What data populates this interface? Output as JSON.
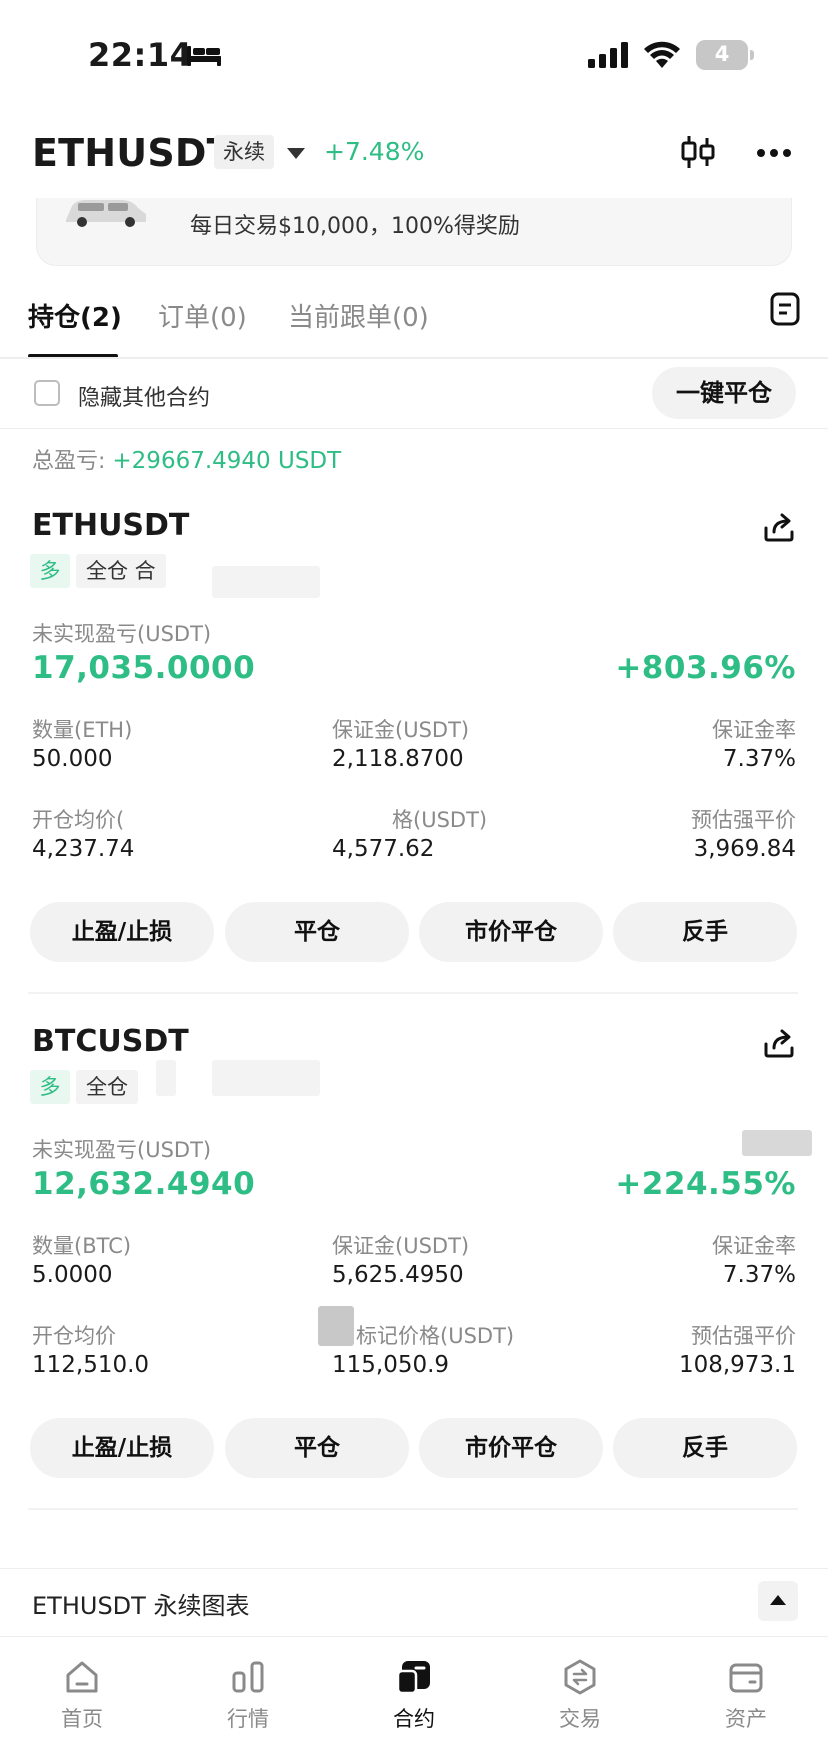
{
  "status_bar": {
    "time": "22:14",
    "battery": "4"
  },
  "header": {
    "symbol": "ETHUSDT",
    "perp_tag": "永续",
    "change": "+7.48%"
  },
  "banner": {
    "text": "每日交易$10,000，100%得奖励"
  },
  "tabs": [
    {
      "label": "持仓(2)"
    },
    {
      "label": "订单(0)"
    },
    {
      "label": "当前跟单(0)"
    }
  ],
  "filter": {
    "hide_label": "隐藏其他合约",
    "close_all": "一键平仓"
  },
  "summary": {
    "total_pnl_label": "总盈亏: ",
    "total_pnl_value": "+29667.4940 USDT"
  },
  "positions": [
    {
      "symbol": "ETHUSDT",
      "side": "多",
      "mode": "全仓 合",
      "pnl_label": "未实现盈亏(USDT)",
      "pnl": "17,035.0000",
      "roe": "+803.96%",
      "qty_label": "数量(ETH)",
      "qty": "50.000",
      "margin_label": "保证金(USDT)",
      "margin": "2,118.8700",
      "margin_rate_label": "保证金率",
      "margin_rate": "7.37%",
      "entry_label": "开仓均价(",
      "entry": "4,237.74",
      "mark_label": "格(USDT)",
      "mark": "4,577.62",
      "liq_label": "预估强平价",
      "liq": "3,969.84"
    },
    {
      "symbol": "BTCUSDT",
      "side": "多",
      "mode": "全仓",
      "pnl_label": "未实现盈亏(USDT)",
      "pnl": "12,632.4940",
      "roe": "+224.55%",
      "qty_label": "数量(BTC)",
      "qty": "5.0000",
      "margin_label": "保证金(USDT)",
      "margin": "5,625.4950",
      "margin_rate_label": "保证金率",
      "margin_rate": "7.37%",
      "entry_label": "开仓均价",
      "entry": "112,510.0",
      "mark_label": "标记价格(USDT)",
      "mark": "115,050.9",
      "liq_label": "预估强平价",
      "liq": "108,973.1"
    }
  ],
  "actions": {
    "tp_sl": "止盈/止损",
    "close": "平仓",
    "market_close": "市价平仓",
    "reverse": "反手"
  },
  "chart_bar": {
    "title": "ETHUSDT 永续图表"
  },
  "nav": [
    {
      "label": "首页",
      "icon": "home-icon"
    },
    {
      "label": "行情",
      "icon": "market-icon"
    },
    {
      "label": "合约",
      "icon": "futures-icon"
    },
    {
      "label": "交易",
      "icon": "trade-icon"
    },
    {
      "label": "资产",
      "icon": "wallet-icon"
    }
  ],
  "colors": {
    "up": "#2ebd85",
    "text": "#1a1a1a",
    "muted": "#8a8a8a"
  }
}
